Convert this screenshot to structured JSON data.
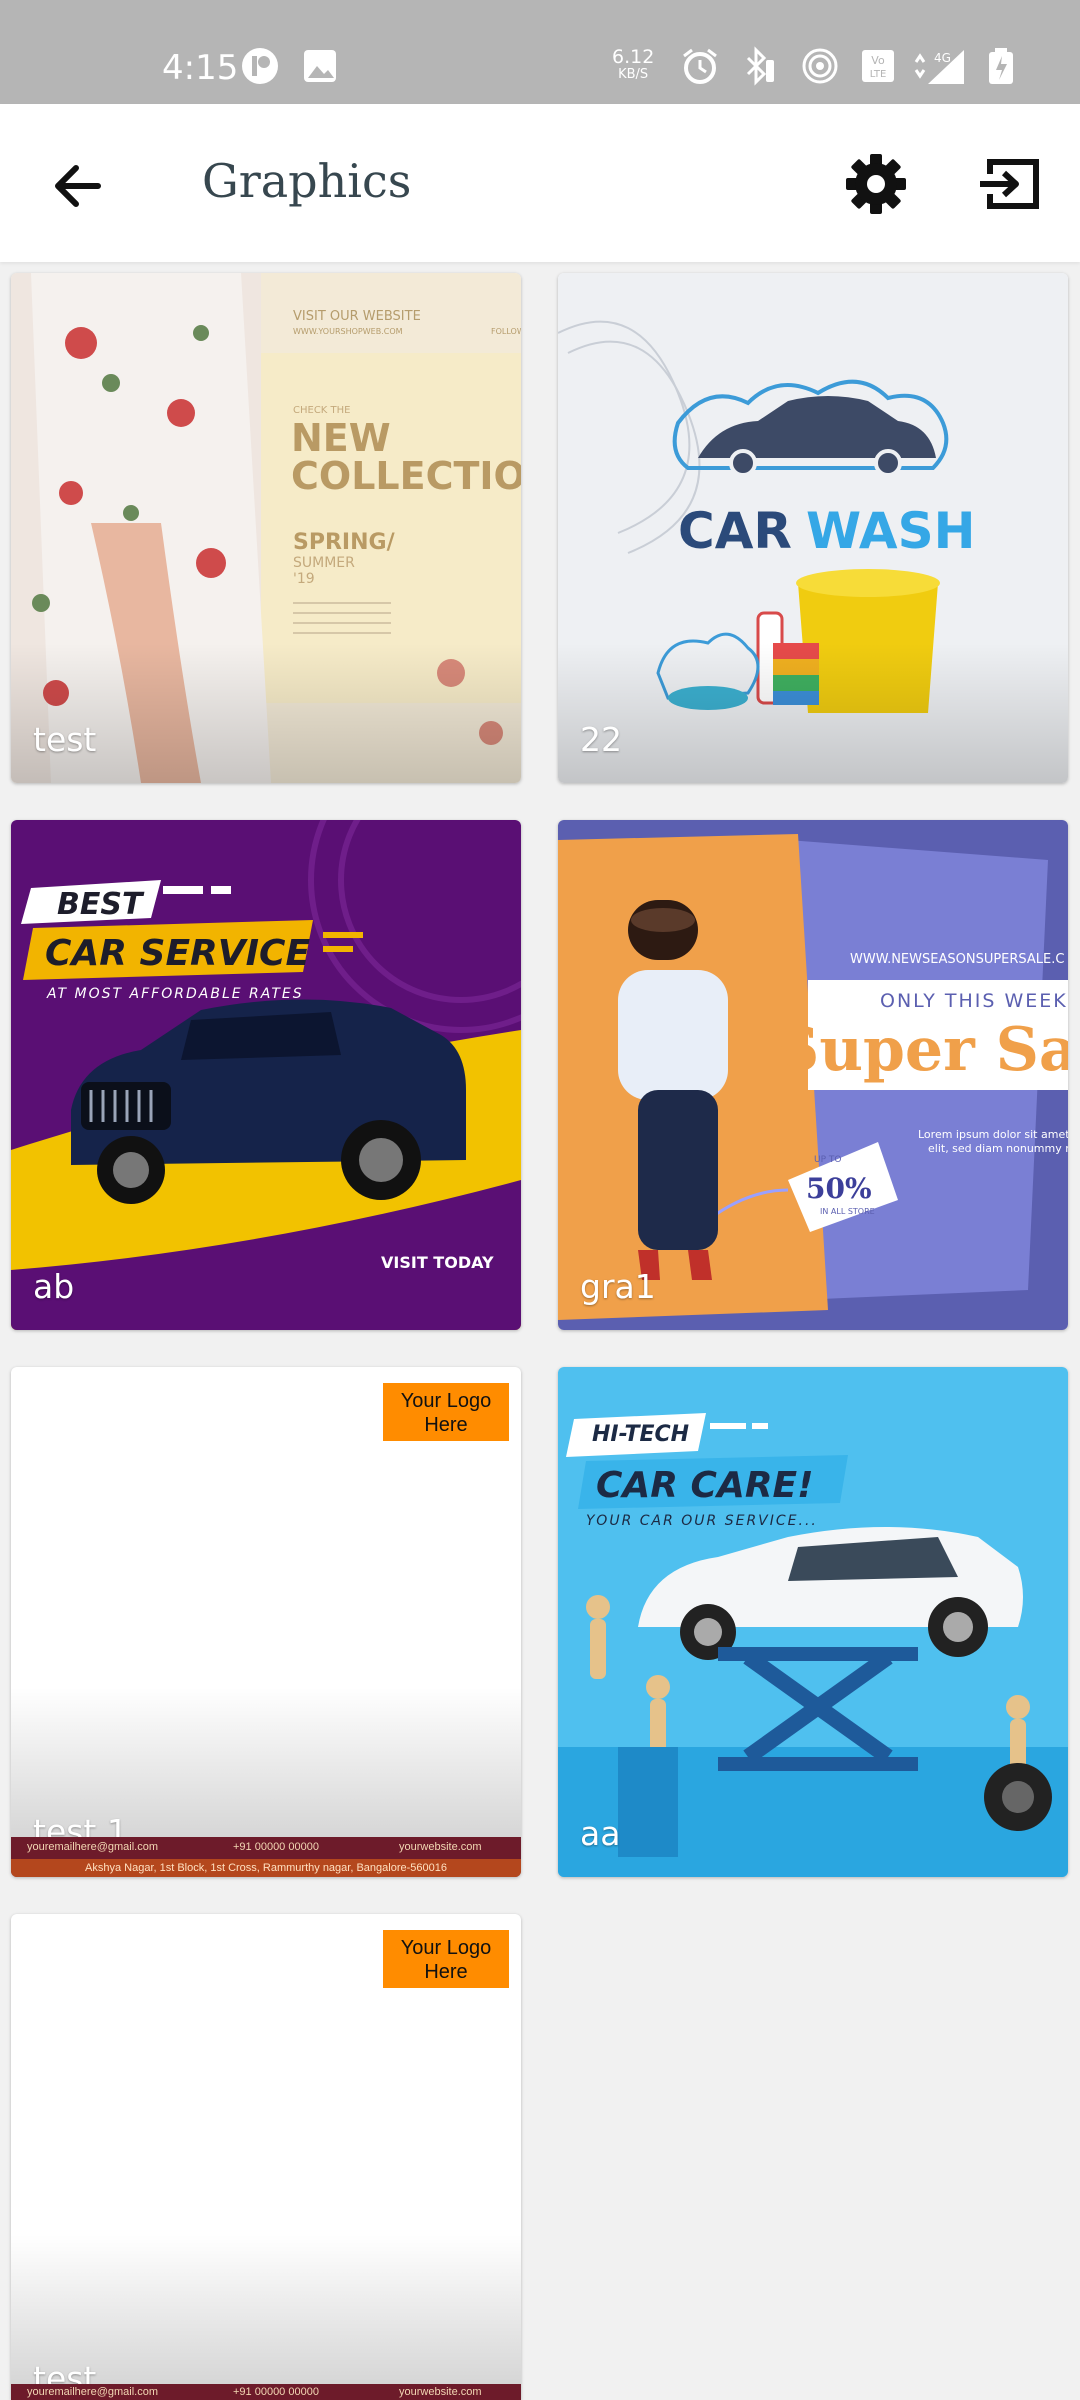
{
  "status_bar": {
    "time": "4:15",
    "speed_value": "6.12",
    "speed_unit": "KB/S",
    "icons": [
      "app-icon",
      "image-icon",
      "alarm-icon",
      "bluetooth-icon",
      "hotspot-icon",
      "volte-icon",
      "signal-4g-icon",
      "battery-icon"
    ]
  },
  "app_bar": {
    "title": "Graphics",
    "back_icon": "arrow-back-icon",
    "settings_icon": "gear-icon",
    "exit_icon": "exit-icon"
  },
  "cards": [
    {
      "label": "test",
      "art": {
        "line1": "VISIT OUR WEBSITE",
        "line2": "WWW.YOURSHOPWEB.COM",
        "line3": "FOLLOW",
        "small": "CHECK THE",
        "headline1": "NEW",
        "headline2": "COLLECTION",
        "season": "SPRING/",
        "season2": "SUMMER",
        "year": "'19"
      }
    },
    {
      "label": "22",
      "art": {
        "brand_a": "CAR",
        "brand_b": "WASH"
      }
    },
    {
      "label": "ab",
      "art": {
        "badge": "BEST",
        "headline": "CAR SERVICE",
        "sub": "AT MOST AFFORDABLE RATES",
        "cta": "VISIT TODAY"
      }
    },
    {
      "label": "gra1",
      "art": {
        "url": "WWW.NEWSEASONSUPERSALE.C",
        "tag": "ONLY THIS WEEK",
        "headline": "Super Sa",
        "body1": "Lorem ipsum dolor sit amet, c",
        "body2": "elit, sed diam nonummy n",
        "upto": "UP TO",
        "discount": "50%",
        "store": "IN ALL STORE"
      }
    },
    {
      "label": "test 1",
      "logo_text": "Your Logo Here",
      "footer": {
        "email": "youremailhere@gmail.com",
        "phone": "+91 00000 00000",
        "web": "yourwebsite.com",
        "address": "Akshya Nagar, 1st Block, 1st Cross, Rammurthy nagar, Bangalore-560016"
      }
    },
    {
      "label": "aa",
      "art": {
        "badge": "HI-TECH",
        "headline": "CAR CARE!",
        "sub": "YOUR CAR OUR SERVICE..."
      }
    },
    {
      "label": "test",
      "logo_text": "Your Logo Here",
      "footer": {
        "email": "youremailhere@gmail.com",
        "phone": "+91 00000 00000",
        "web": "yourwebsite.com"
      }
    }
  ],
  "colors": {
    "status_bar_bg": "#b5b5b5",
    "app_bar_bg": "#ffffff",
    "title_color": "#37474f",
    "logo_box": "#ff8c00",
    "footer_strip": "#6d1b2a"
  }
}
